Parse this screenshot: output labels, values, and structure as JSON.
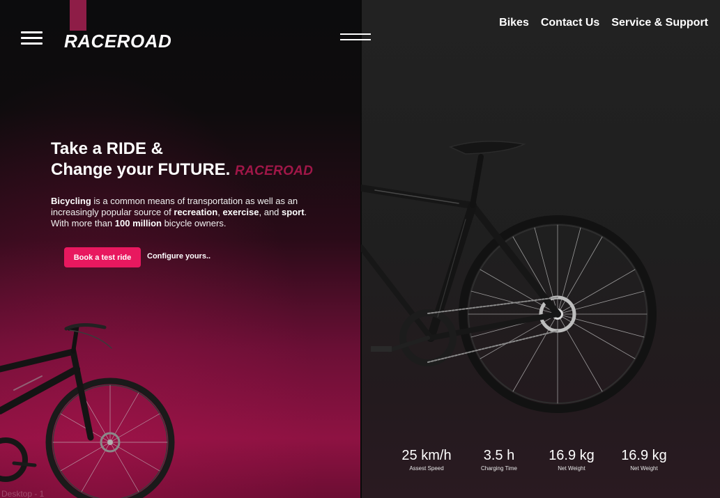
{
  "brand": {
    "name": "RACEROAD"
  },
  "nav": {
    "items": [
      {
        "label": "Bikes"
      },
      {
        "label": "Contact Us"
      },
      {
        "label": "Service & Support"
      }
    ]
  },
  "hero": {
    "title_line1": "Take a RIDE &",
    "title_line2": "Change your FUTURE.",
    "title_brand": "RACEROAD",
    "desc": {
      "p1_bold": "Bicycling",
      "p1": " is a common means of transportation as well as an increasingly popular source of ",
      "p2_bold": "recreation",
      "p2": ", ",
      "p3_bold": "exercise",
      "p3": ", and ",
      "p4_bold": "sport",
      "p4": ". With more than ",
      "p5_bold": "100 million",
      "p5": " bicycle owners."
    },
    "cta_primary": "Book a test ride",
    "cta_secondary": "Configure yours.."
  },
  "stats": [
    {
      "value": "25 km/h",
      "label": "Assest Speed"
    },
    {
      "value": "3.5 h",
      "label": "Charging Time"
    },
    {
      "value": "16.9 kg",
      "label": "Net Weight"
    },
    {
      "value": "16.9 kg",
      "label": "Net Weight"
    }
  ],
  "frame_label": "Desktop - 1",
  "colors": {
    "accent": "#e8185f",
    "brand_inline": "#a01748",
    "accent_bar": "#8e1d47",
    "dark_bg": "#1f1f1f"
  }
}
